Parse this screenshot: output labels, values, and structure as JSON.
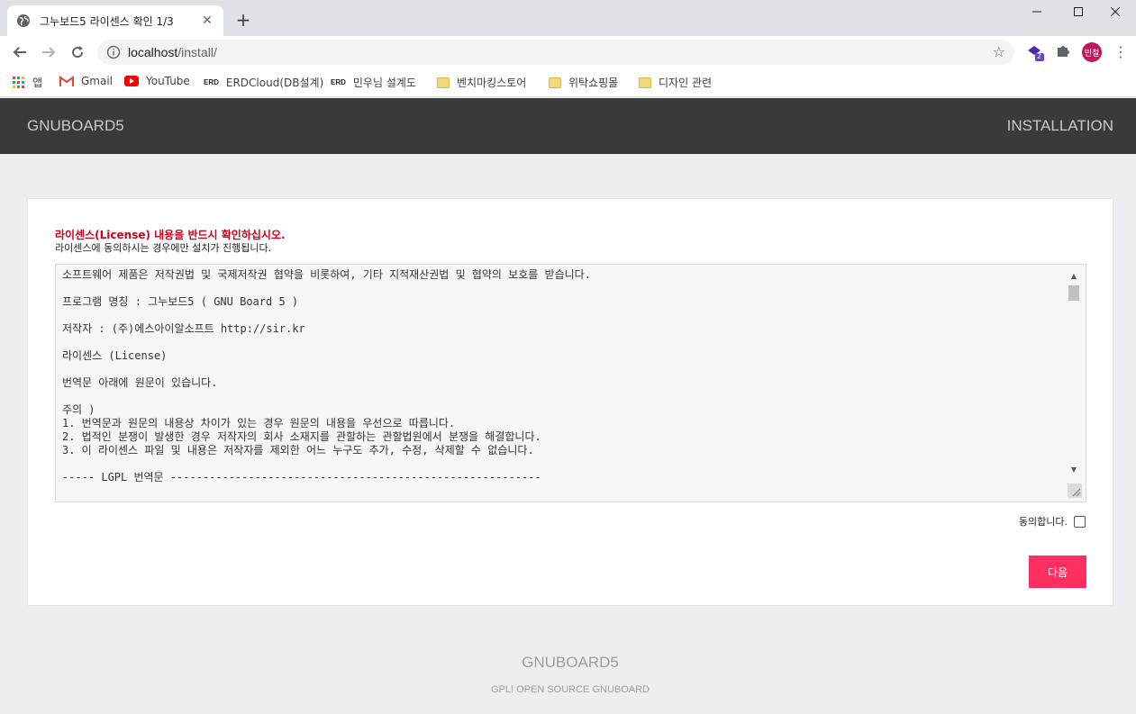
{
  "browser": {
    "tab_title": "그누보드5 라이센스 확인 1/3",
    "tab_close": "✕",
    "new_tab": "+",
    "url_host": "localhost",
    "url_path": "/install/",
    "bookmarks": [
      {
        "label": "앱",
        "icon": "apps-grid-icon"
      },
      {
        "label": "Gmail",
        "icon": "gmail-icon"
      },
      {
        "label": "YouTube",
        "icon": "youtube-icon"
      },
      {
        "label": "ERDCloud(DB설계)",
        "icon": "erd-icon"
      },
      {
        "label": "민우님 설계도",
        "icon": "erd-icon"
      },
      {
        "label": "벤치마킹스토어",
        "icon": "folder-icon"
      },
      {
        "label": "위탁쇼핑몰",
        "icon": "folder-icon"
      },
      {
        "label": "디자인 관련",
        "icon": "folder-icon"
      }
    ],
    "erd_badge": "ERD",
    "extension_badge": "2",
    "profile": "민철"
  },
  "site": {
    "logo": "GNUBOARD5",
    "header_right": "INSTALLATION"
  },
  "license": {
    "warning": "라이센스(License) 내용을 반드시 확인하십시오.",
    "subtitle": "라이센스에 동의하시는 경우에만 설치가 진행됩니다.",
    "text": "소프트웨어 제품은 저작권법 및 국제저작권 협약을 비롯하여, 기타 지적재산권법 및 협약의 보호를 받습니다.\n\n프로그램 명칭 : 그누보드5 ( GNU Board 5 )\n\n저작자 : (주)에스아이알소프트 http://sir.kr\n\n라이센스 (License)\n\n번역문 아래에 원문이 있습니다.\n\n주의 )\n1. 번역문과 원문의 내용상 차이가 있는 경우 원문의 내용을 우선으로 따릅니다.\n2. 법적인 분쟁이 발생한 경우 저작자의 회사 소재지를 관할하는 관할법원에서 분쟁을 해결합니다.\n3. 이 라이센스 파일 및 내용은 저작자를 제외한 어느 누구도 추가, 수정, 삭제할 수 없습니다.\n\n----- LGPL 번역문 ---------------------------------------------------------",
    "agree_label": "동의합니다.",
    "next_button": "다음"
  },
  "footer": {
    "logo": "GNUBOARD5",
    "tagline": "GPL! OPEN SOURCE GNUBOARD"
  },
  "colors": {
    "header_bg": "#3a3a3a",
    "warning": "#d0021b",
    "next_button": "#ff3061"
  }
}
